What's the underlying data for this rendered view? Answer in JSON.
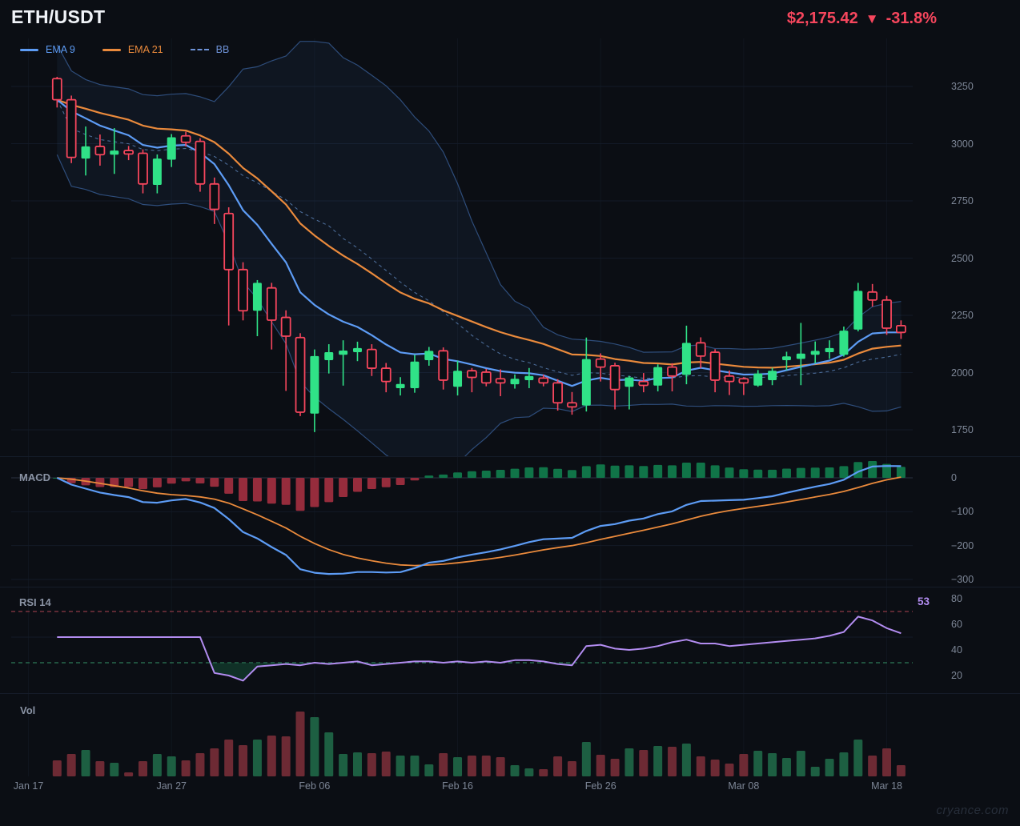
{
  "header": {
    "symbol": "ETH/USDT",
    "price": "$2,175.42",
    "change_arrow": "▼",
    "change_percent": "-31.8%"
  },
  "legend": {
    "items": [
      {
        "label": "EMA 9",
        "color": "#5d9cf5",
        "style": "solid"
      },
      {
        "label": "EMA 21",
        "color": "#ea8a3c",
        "style": "solid"
      },
      {
        "label": "BB",
        "color": "#6e92d8",
        "style": "dashed"
      }
    ]
  },
  "panels": {
    "macd": {
      "label": "MACD"
    },
    "rsi": {
      "label": "RSI 14",
      "value": "53"
    },
    "volume": {
      "label": "Vol"
    }
  },
  "watermark": "cryance.com",
  "colors": {
    "background": "#0b0e14",
    "bull": "#30e287",
    "bear": "#f6465d",
    "ema9": "#5d9cf5",
    "ema21": "#ea8a3c",
    "bb_band": "#2e4d7b",
    "bb_mid": "#4b6b97",
    "bb_fill": "rgba(58,98,160,0.10)",
    "macd_line": "#5d9cf5",
    "macd_signal": "#ea8a3c",
    "hist_pos": "#107448",
    "hist_neg": "#962c3c",
    "rsi_line": "#b28cf0",
    "rsi_overbought": "#8e3a46",
    "rsi_oversold": "#2c7a57",
    "rsi_fill": "rgba(22,94,62,0.45)",
    "vol_up": "#1d5f42",
    "vol_down": "#6d2a34",
    "axis_text": "#7d8696",
    "grid": "#131a27",
    "vgrid": "#10161f",
    "zero_line": "#2b3342",
    "separator": "#151c29",
    "price_text": "#f6465d"
  },
  "chart_data": {
    "type": "candlestick",
    "title": "ETH/USDT daily with EMA 9, EMA 21, Bollinger Bands, MACD, RSI 14 and Volume",
    "x_axis": {
      "labels": [
        {
          "label": "Jan 17",
          "i": -2
        },
        {
          "label": "Jan 27",
          "i": 8
        },
        {
          "label": "Feb 06",
          "i": 18
        },
        {
          "label": "Feb 16",
          "i": 28
        },
        {
          "label": "Feb 26",
          "i": 38
        },
        {
          "label": "Mar 08",
          "i": 48
        },
        {
          "label": "Mar 18",
          "i": 58
        }
      ]
    },
    "y_axis": {
      "price_ticks": [
        3250,
        3000,
        2750,
        2500,
        2250,
        2000,
        1750
      ],
      "range": [
        1660,
        3470
      ]
    },
    "macd_axis_ticks": [
      "0",
      "−100",
      "−200",
      "−300"
    ],
    "rsi_axis_ticks": [
      "80",
      "60",
      "40",
      "20"
    ],
    "candles_format": [
      "date",
      "open",
      "high",
      "low",
      "close",
      "volume_rel"
    ],
    "candles": [
      [
        "Jan 19",
        3284,
        3292,
        3158,
        3192,
        20
      ],
      [
        "Jan 20",
        3192,
        3210,
        2915,
        2940,
        28
      ],
      [
        "Jan 21",
        2935,
        3075,
        2861,
        2988,
        33
      ],
      [
        "Jan 22",
        2988,
        3040,
        2904,
        2952,
        19
      ],
      [
        "Jan 23",
        2952,
        3068,
        2868,
        2970,
        17
      ],
      [
        "Jan 24",
        2970,
        2990,
        2928,
        2955,
        5
      ],
      [
        "Jan 25",
        2958,
        2975,
        2783,
        2824,
        19
      ],
      [
        "Jan 26",
        2820,
        2953,
        2783,
        2935,
        28
      ],
      [
        "Jan 27",
        2930,
        3042,
        2898,
        3028,
        25
      ],
      [
        "Jan 28",
        3034,
        3052,
        2988,
        3006,
        20
      ],
      [
        "Jan 29",
        3010,
        3024,
        2790,
        2824,
        29
      ],
      [
        "Jan 30",
        2824,
        2852,
        2649,
        2713,
        35
      ],
      [
        "Jan 31",
        2695,
        2722,
        2206,
        2450,
        46
      ],
      [
        "Feb 01",
        2450,
        2482,
        2228,
        2270,
        39
      ],
      [
        "Feb 02",
        2270,
        2404,
        2159,
        2392,
        46
      ],
      [
        "Feb 03",
        2370,
        2392,
        2101,
        2229,
        51
      ],
      [
        "Feb 04",
        2241,
        2272,
        1920,
        2159,
        50
      ],
      [
        "Feb 05",
        2153,
        2172,
        1810,
        1827,
        81
      ],
      [
        "Feb 06",
        1821,
        2101,
        1740,
        2072,
        74
      ],
      [
        "Feb 07",
        2054,
        2124,
        1996,
        2089,
        55
      ],
      [
        "Feb 08",
        2078,
        2141,
        1943,
        2096,
        28
      ],
      [
        "Feb 09",
        2089,
        2135,
        2050,
        2107,
        30
      ],
      [
        "Feb 10",
        2101,
        2124,
        1985,
        2019,
        29
      ],
      [
        "Feb 11",
        2019,
        2042,
        1914,
        1961,
        31
      ],
      [
        "Feb 12",
        1932,
        1980,
        1900,
        1950,
        26
      ],
      [
        "Feb 13",
        1932,
        2078,
        1912,
        2048,
        26
      ],
      [
        "Feb 14",
        2054,
        2112,
        2030,
        2095,
        15
      ],
      [
        "Feb 15",
        2095,
        2110,
        1926,
        1967,
        29
      ],
      [
        "Feb 16",
        1938,
        2052,
        1900,
        2008,
        24
      ],
      [
        "Feb 17",
        2008,
        2020,
        1914,
        1979,
        26
      ],
      [
        "Feb 18",
        2002,
        2016,
        1940,
        1955,
        26
      ],
      [
        "Feb 19",
        1973,
        2014,
        1897,
        1955,
        24
      ],
      [
        "Feb 20",
        1949,
        1992,
        1930,
        1973,
        14
      ],
      [
        "Feb 21",
        1967,
        2020,
        1932,
        1985,
        10
      ],
      [
        "Feb 22",
        1976,
        1991,
        1940,
        1955,
        9
      ],
      [
        "Feb 23",
        1955,
        1971,
        1834,
        1868,
        25
      ],
      [
        "Feb 24",
        1868,
        1915,
        1816,
        1850,
        19
      ],
      [
        "Feb 25",
        1856,
        2153,
        1830,
        2059,
        43
      ],
      [
        "Feb 26",
        2059,
        2084,
        1961,
        2024,
        27
      ],
      [
        "Feb 27",
        2030,
        2043,
        1839,
        1926,
        22
      ],
      [
        "Feb 28",
        1938,
        1986,
        1839,
        1979,
        35
      ],
      [
        "Mar 01",
        1961,
        1998,
        1914,
        1944,
        33
      ],
      [
        "Mar 02",
        1943,
        2036,
        1918,
        2024,
        38
      ],
      [
        "Mar 03",
        2024,
        2041,
        1918,
        1985,
        37
      ],
      [
        "Mar 04",
        1990,
        2205,
        1949,
        2130,
        41
      ],
      [
        "Mar 05",
        2130,
        2154,
        2019,
        2072,
        25
      ],
      [
        "Mar 06",
        2089,
        2102,
        1914,
        1967,
        21
      ],
      [
        "Mar 07",
        1985,
        2009,
        1902,
        1961,
        16
      ],
      [
        "Mar 08",
        1973,
        1980,
        1902,
        1955,
        28
      ],
      [
        "Mar 09",
        1943,
        2011,
        1938,
        1996,
        32
      ],
      [
        "Mar 10",
        1967,
        2021,
        1945,
        2008,
        29
      ],
      [
        "Mar 11",
        2054,
        2091,
        2010,
        2071,
        23
      ],
      [
        "Mar 12",
        2060,
        2217,
        1945,
        2083,
        32
      ],
      [
        "Mar 13",
        2078,
        2136,
        2040,
        2095,
        12
      ],
      [
        "Mar 14",
        2089,
        2141,
        2060,
        2107,
        22
      ],
      [
        "Mar 15",
        2078,
        2201,
        2070,
        2183,
        30
      ],
      [
        "Mar 16",
        2188,
        2392,
        2180,
        2357,
        46
      ],
      [
        "Mar 17",
        2352,
        2387,
        2288,
        2317,
        26
      ],
      [
        "Mar 18",
        2317,
        2335,
        2165,
        2194,
        35
      ],
      [
        "Mar 19",
        2205,
        2228,
        2147,
        2175.42,
        14
      ]
    ],
    "indicators": {
      "ema9": {
        "label": "EMA 9",
        "period": 9
      },
      "ema21": {
        "label": "EMA 21",
        "period": 21
      },
      "bollinger": {
        "label": "BB",
        "period": 20,
        "stddev": 2
      },
      "macd": {
        "label": "MACD",
        "axis_range": [
          60,
          -310
        ]
      },
      "rsi14": {
        "label": "RSI 14",
        "overbought": 70,
        "oversold": 30,
        "current": 53,
        "values": [
          50,
          50,
          50,
          50,
          50,
          50,
          50,
          50,
          50,
          50,
          50,
          22,
          20,
          16,
          27,
          28,
          29,
          28,
          30,
          29,
          30,
          31,
          28,
          29,
          30,
          31,
          31,
          30,
          31,
          30,
          31,
          30,
          32,
          32,
          31,
          29,
          28,
          43,
          44,
          41,
          40,
          41,
          43,
          46,
          48,
          45,
          45,
          43,
          44,
          45,
          46,
          47,
          48,
          49,
          51,
          54,
          66,
          63,
          57,
          53
        ]
      }
    }
  }
}
